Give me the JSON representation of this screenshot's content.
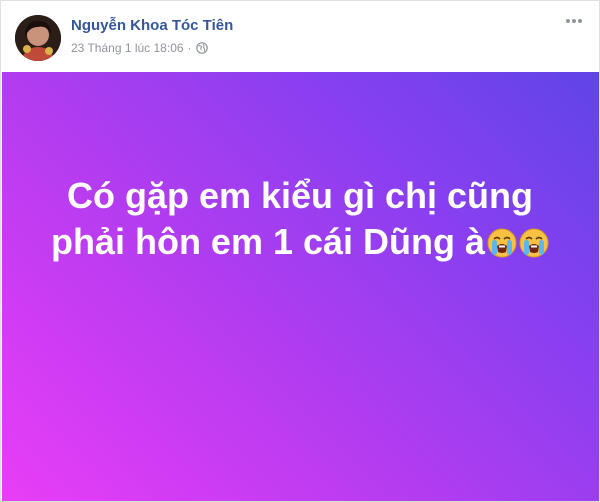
{
  "post": {
    "author": "Nguyễn Khoa Tóc Tiên",
    "timestamp": "23 Tháng 1 lúc 18:06",
    "separator": "·",
    "privacy_icon": "globe-icon",
    "more_icon": "more-options-icon",
    "text_line1": "Có gặp em kiểu gì chị cũng",
    "text_line2": "phải hôn em 1 cái Dũng à",
    "emoji": "loudly-crying-face",
    "background_gradient": [
      "#e93df7",
      "#b53cf0",
      "#8a3ff0",
      "#5f45e6"
    ]
  },
  "colors": {
    "author_link": "#365899",
    "meta_text": "#90949c"
  }
}
